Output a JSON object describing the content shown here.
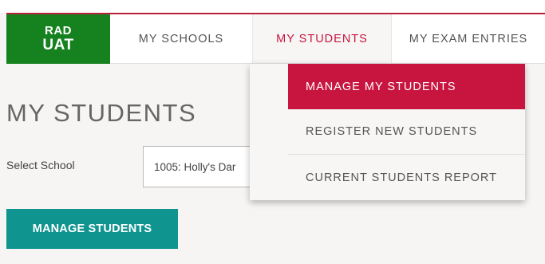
{
  "logo": {
    "line1": "RAD",
    "line2": "UAT"
  },
  "nav": {
    "schools": "MY SCHOOLS",
    "students": "MY STUDENTS",
    "exams": "MY EXAM ENTRIES"
  },
  "dropdown": {
    "items": [
      {
        "label": "MANAGE MY STUDENTS",
        "active": true
      },
      {
        "label": "REGISTER NEW STUDENTS",
        "active": false
      },
      {
        "label": "CURRENT STUDENTS REPORT",
        "active": false
      }
    ]
  },
  "main": {
    "title": "MY STUDENTS",
    "select_label": "Select School",
    "school_value": "1005: Holly's Dar",
    "manage_button": "MANAGE STUDENTS"
  },
  "colors": {
    "brand_red": "#c8153f",
    "logo_green": "#15821f",
    "button_teal": "#0f948f"
  }
}
